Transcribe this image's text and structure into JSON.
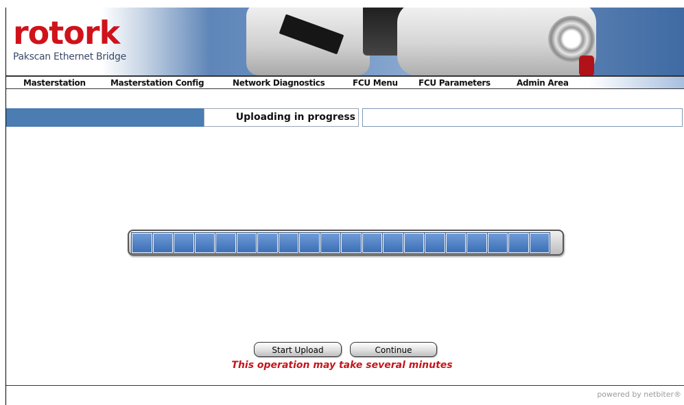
{
  "brand": {
    "logo_text": "rotork",
    "product_name": "Pakscan Ethernet Bridge"
  },
  "nav": {
    "items": [
      {
        "label": "Masterstation"
      },
      {
        "label": "Masterstation Config"
      },
      {
        "label": "Network Diagnostics"
      },
      {
        "label": "FCU Menu"
      },
      {
        "label": "FCU Parameters"
      },
      {
        "label": "Admin Area"
      }
    ]
  },
  "page": {
    "title": "Uploading in progress"
  },
  "progress": {
    "segments_total": 20,
    "segments_filled": 20,
    "fraction": 1.0
  },
  "actions": {
    "start_upload": "Start Upload",
    "continue": "Continue"
  },
  "warning": "This operation may take several minutes",
  "footer": {
    "powered_by": "powered by netbiter®"
  },
  "colors": {
    "brand_red": "#d0121b",
    "accent_blue": "#4b7cb2",
    "progress_blue": "#3c6fb6",
    "warning_red": "#c4161c"
  },
  "icons": {
    "header_illustration": "actuator-illustration"
  }
}
